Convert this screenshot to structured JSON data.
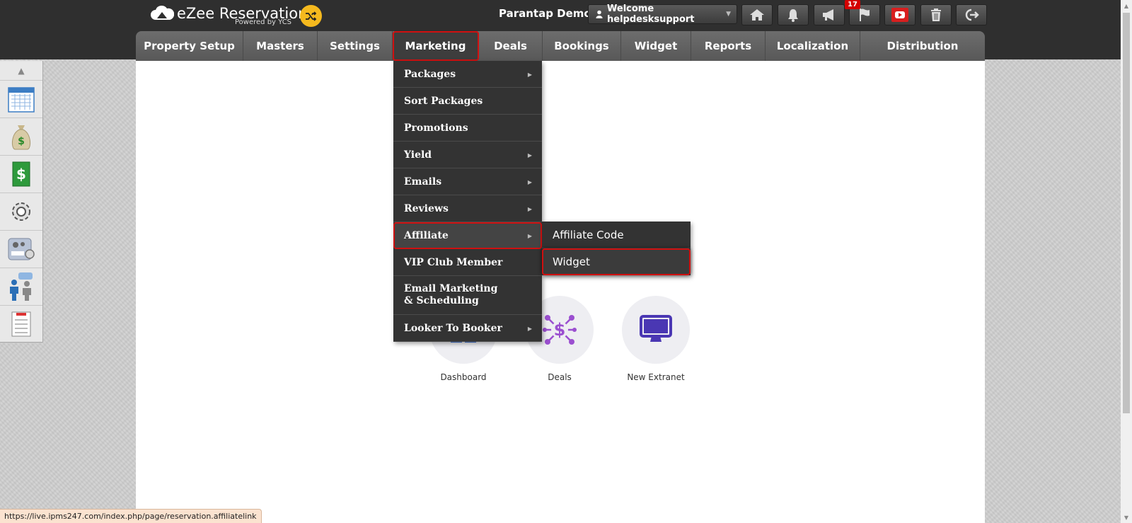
{
  "header": {
    "brand": "eZee Reservation",
    "powered_by": "Powered by YCS",
    "property_name": "Parantap Demo",
    "welcome": "Welcome helpdesksupport",
    "notification_count": "17"
  },
  "nav": {
    "items": [
      {
        "label": "Property Setup"
      },
      {
        "label": "Masters"
      },
      {
        "label": "Settings"
      },
      {
        "label": "Marketing"
      },
      {
        "label": "Deals"
      },
      {
        "label": "Bookings"
      },
      {
        "label": "Widget"
      },
      {
        "label": "Reports"
      },
      {
        "label": "Localization"
      },
      {
        "label": "Distribution"
      }
    ]
  },
  "marketing_menu": {
    "items": [
      {
        "label": "Packages"
      },
      {
        "label": "Sort Packages"
      },
      {
        "label": "Promotions"
      },
      {
        "label": "Yield"
      },
      {
        "label": "Emails"
      },
      {
        "label": "Reviews"
      },
      {
        "label": "Affiliate"
      },
      {
        "label": "VIP Club Member"
      },
      {
        "label": "Email Marketing & Scheduling"
      },
      {
        "label": "Looker To Booker"
      }
    ]
  },
  "affiliate_submenu": {
    "items": [
      {
        "label": "Affiliate Code"
      },
      {
        "label": "Widget"
      }
    ]
  },
  "quick_links": [
    {
      "label": "Dashboard"
    },
    {
      "label": "Deals"
    },
    {
      "label": "New Extranet"
    }
  ],
  "status_url": "https://live.ipms247.com/index.php/page/reservation.affiliatelink",
  "colors": {
    "accent_yellow": "#f5b91e",
    "highlight_red": "#d01010",
    "deals_purple": "#9b4fd0",
    "extranet_indigo": "#4a37b3"
  }
}
